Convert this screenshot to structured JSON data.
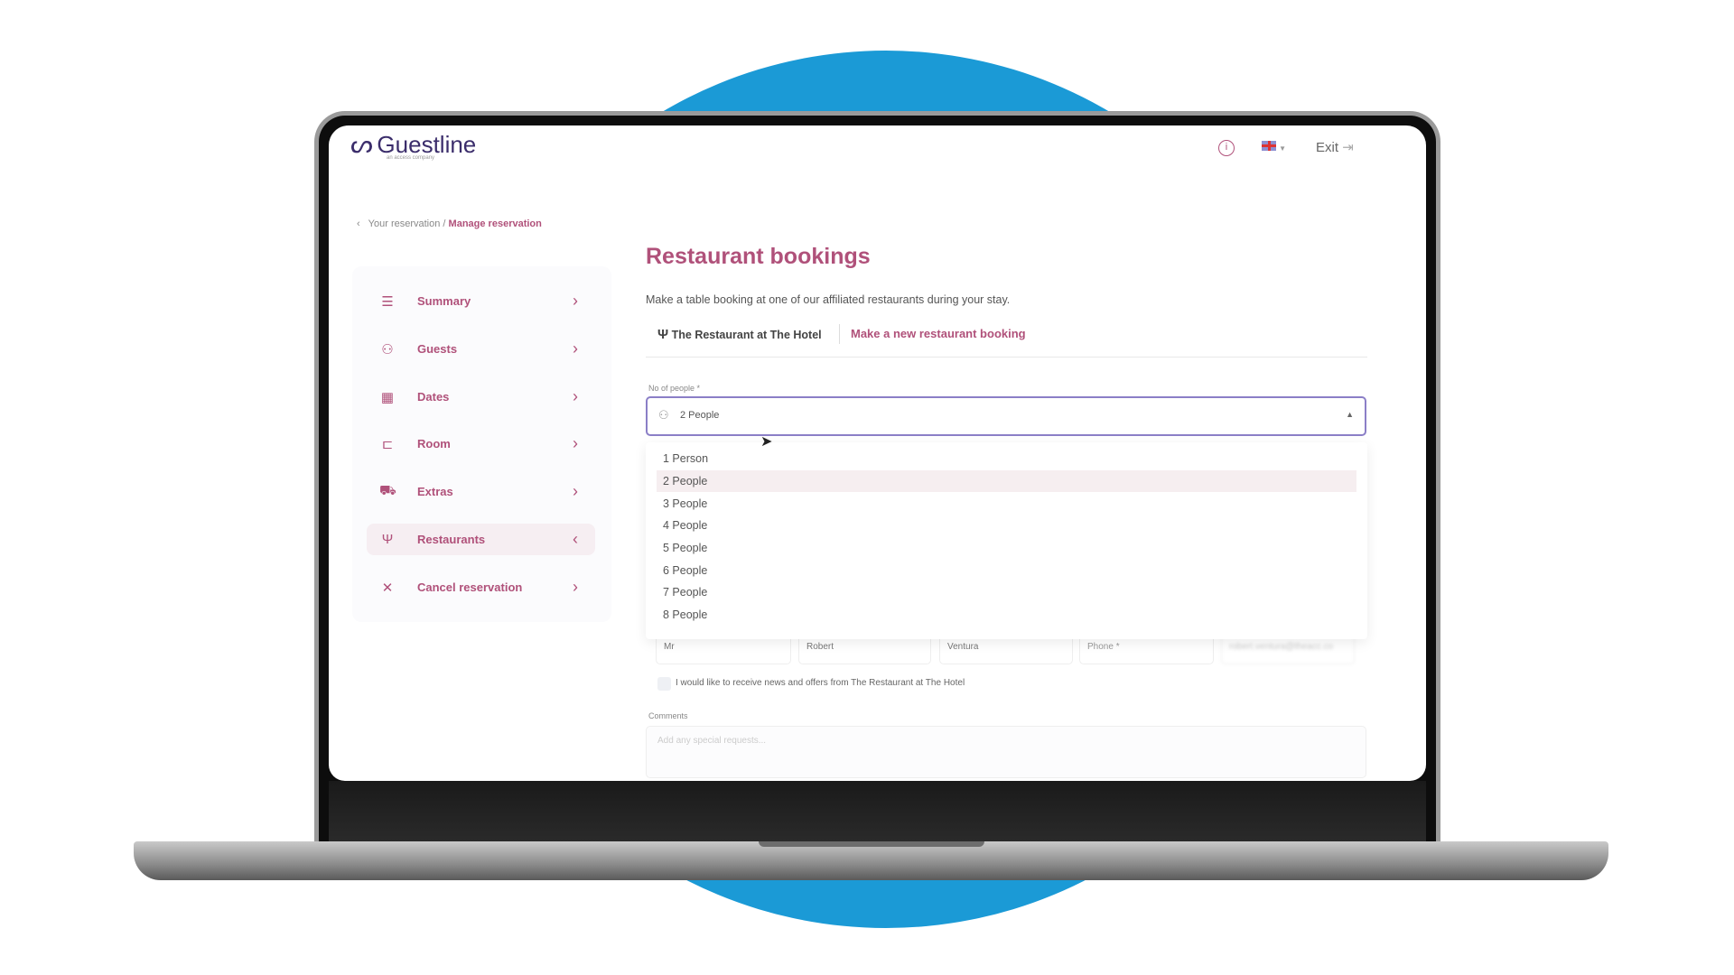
{
  "header": {
    "logo_text": "Guestline",
    "logo_sub": "an access company",
    "info_icon": "info-icon",
    "language_flag": "uk-flag-icon",
    "exit_label": "Exit"
  },
  "breadcrumb": {
    "parent": "Your reservation",
    "separator": "/",
    "current": "Manage reservation"
  },
  "sidebar": {
    "items": [
      {
        "label": "Summary",
        "icon": "summary-list-icon"
      },
      {
        "label": "Guests",
        "icon": "guests-icon"
      },
      {
        "label": "Dates",
        "icon": "calendar-icon"
      },
      {
        "label": "Room",
        "icon": "bed-icon"
      },
      {
        "label": "Extras",
        "icon": "cart-icon"
      },
      {
        "label": "Restaurants",
        "icon": "cutlery-icon",
        "active": true
      },
      {
        "label": "Cancel reservation",
        "icon": "close-icon"
      }
    ]
  },
  "main": {
    "title": "Restaurant bookings",
    "description": "Make a table booking at one of our affiliated restaurants during your stay.",
    "restaurant_tab": "The Restaurant at The Hotel",
    "new_booking_link": "Make a new restaurant booking",
    "people_label": "No of people *",
    "people_value": "2 People",
    "people_options": [
      "1 Person",
      "2 People",
      "3 People",
      "4 People",
      "5 People",
      "6 People",
      "7 People",
      "8 People"
    ],
    "guest_fields": {
      "title": "Mr",
      "first_name": "Robert",
      "last_name": "Ventura",
      "phone_placeholder": "Phone *",
      "email": "robert.ventura@theacc.co"
    },
    "newsletter_label": "I would like to receive news and offers from The Restaurant at The Hotel",
    "comments_label": "Comments",
    "comments_placeholder": "Add any special requests..."
  },
  "colors": {
    "accent": "#b0517a",
    "background_circle": "#1b9ad6",
    "select_border": "#8b7fc7"
  }
}
